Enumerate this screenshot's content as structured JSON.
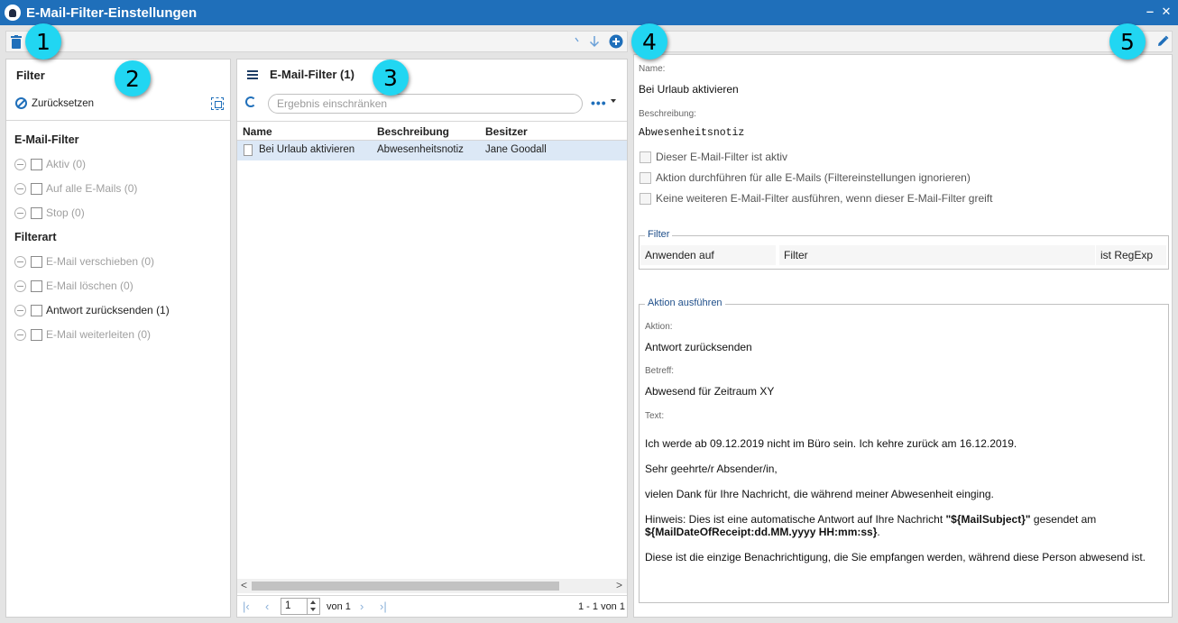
{
  "window": {
    "title": "E-Mail-Filter-Einstellungen",
    "minimize": "‒",
    "close": "✕"
  },
  "badges": [
    "1",
    "2",
    "3",
    "4",
    "5"
  ],
  "icons": {
    "delete": "trash-icon",
    "sort_up": "arrow-up-icon",
    "sort_down": "arrow-down-icon",
    "add": "plus-circle-icon",
    "edit": "pencil-icon",
    "accent": "#1f6fba"
  },
  "filter_panel": {
    "title": "Filter",
    "reset_label": "Zurücksetzen",
    "groups": [
      {
        "title": "E-Mail-Filter",
        "items": [
          {
            "label": "Aktiv (0)",
            "active": false
          },
          {
            "label": "Auf alle E-Mails (0)",
            "active": false
          },
          {
            "label": "Stop (0)",
            "active": false
          }
        ]
      },
      {
        "title": "Filterart",
        "items": [
          {
            "label": "E-Mail verschieben (0)",
            "active": false
          },
          {
            "label": "E-Mail löschen (0)",
            "active": false
          },
          {
            "label": "Antwort zurücksenden (1)",
            "active": true
          },
          {
            "label": "E-Mail weiterleiten (0)",
            "active": false
          }
        ]
      }
    ]
  },
  "list_panel": {
    "title": "E-Mail-Filter (1)",
    "search_placeholder": "Ergebnis einschränken",
    "more": "•••",
    "columns": [
      "Name",
      "Beschreibung",
      "Besitzer"
    ],
    "rows": [
      {
        "name": "Bei Urlaub aktivieren",
        "description": "Abwesenheitsnotiz",
        "owner": "Jane Goodall"
      }
    ],
    "pager": {
      "first": "|‹",
      "prev": "‹",
      "page": "1",
      "of": "von 1",
      "next": "›",
      "last": "›|",
      "summary": "1 - 1 von 1"
    },
    "scroll_left": "<",
    "scroll_right": ">"
  },
  "detail": {
    "name_label": "Name:",
    "name": "Bei Urlaub aktivieren",
    "description_label": "Beschreibung:",
    "description": "Abwesenheitsnotiz",
    "checks": [
      "Dieser E-Mail-Filter ist aktiv",
      "Aktion durchführen für alle E-Mails (Filtereinstellungen ignorieren)",
      "Keine weiteren E-Mail-Filter ausführen, wenn dieser E-Mail-Filter greift"
    ],
    "filter": {
      "legend": "Filter",
      "apply_on": "Anwenden auf",
      "filter": "Filter",
      "regexp": "ist RegExp"
    },
    "action": {
      "legend": "Aktion ausführen",
      "action_label": "Aktion:",
      "action": "Antwort zurücksenden",
      "subject_label": "Betreff:",
      "subject": "Abwesend für Zeitraum XY",
      "text_label": "Text:",
      "line1": "Ich werde ab 09.12.2019 nicht im Büro sein. Ich kehre zurück am 16.12.2019.",
      "line2": "Sehr geehrte/r Absender/in,",
      "line3": "vielen Dank für Ihre Nachricht, die während meiner Abwesenheit einging.",
      "hint_prefix": "Hinweis: Dies ist eine automatische Antwort auf Ihre Nachricht ",
      "hint_var1": "\"${MailSubject}\"",
      "hint_mid": " gesendet am ",
      "hint_var2": "${MailDateOfReceipt:dd.MM.yyyy HH:mm:ss}",
      "hint_end": ".",
      "line5": "Diese ist die einzige Benachrichtigung, die Sie empfangen werden, während diese Person abwesend ist."
    }
  }
}
